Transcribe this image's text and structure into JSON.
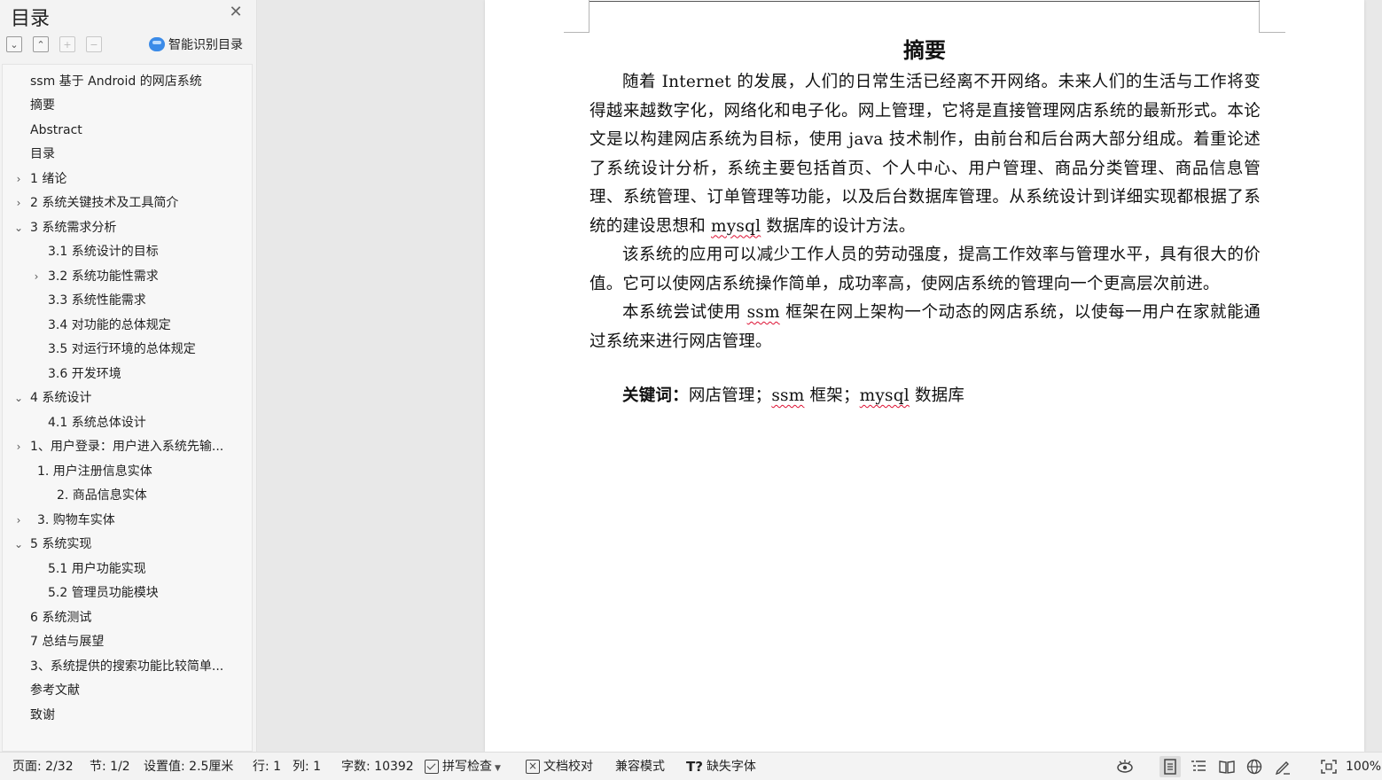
{
  "sidebar": {
    "title": "目录",
    "smart_toc_label": "智能识别目录",
    "items": [
      {
        "label": "ssm 基于 Android 的网店系统"
      },
      {
        "label": "摘要"
      },
      {
        "label": "Abstract"
      },
      {
        "label": "目录"
      },
      {
        "label": "1  绪论"
      },
      {
        "label": "2 系统关键技术及工具简介"
      },
      {
        "label": "3 系统需求分析"
      },
      {
        "label": "3.1 系统设计的目标"
      },
      {
        "label": "3.2 系统功能性需求"
      },
      {
        "label": "3.3 系统性能需求"
      },
      {
        "label": "3.4 对功能的总体规定"
      },
      {
        "label": "3.5 对运行环境的总体规定"
      },
      {
        "label": "3.6 开发环境"
      },
      {
        "label": "4 系统设计"
      },
      {
        "label": "4.1 系统总体设计"
      },
      {
        "label": "1、用户登录：用户进入系统先输..."
      },
      {
        "label": "1. 用户注册信息实体"
      },
      {
        "label": "2.  商品信息实体"
      },
      {
        "label": "3.  购物车实体"
      },
      {
        "label": "5 系统实现"
      },
      {
        "label": "5.1 用户功能实现"
      },
      {
        "label": "5.2 管理员功能模块"
      },
      {
        "label": "6 系统测试"
      },
      {
        "label": "7 总结与展望"
      },
      {
        "label": "3、系统提供的搜索功能比较简单..."
      },
      {
        "label": "参考文献"
      },
      {
        "label": "致谢"
      }
    ]
  },
  "document": {
    "title": "摘要",
    "p1": [
      {
        "text": "随着 Internet 的发展，人们的日常生活已经离不开网络。未来人们的生活与工作将变得越来越数字化，网络化和电子化。网上管理，它将是直接管理网店系统的最新形式。本论文是以构建网店系统为目标，使用 java 技术制作，由前台和后台两大部分组成。着重论述了系统设计分析，系统主要包括首页、个人中心、用户管理、商品分类管理、商品信息管理、系统管理、订单管理等功能，以及后台数据库管理。从系统设计到详细实现都根据了系统的建设思想和 "
      },
      {
        "text": "mysql",
        "spell": true
      },
      {
        "text": " 数据库的设计方法。"
      }
    ],
    "p2": "该系统的应用可以减少工作人员的劳动强度，提高工作效率与管理水平，具有很大的价值。它可以使网店系统操作简单，成功率高，使网店系统的管理向一个更高层次前进。",
    "p3": [
      {
        "text": "本系统尝试使用 "
      },
      {
        "text": "ssm",
        "spell": true
      },
      {
        "text": " 框架在网上架构一个动态的网店系统，以使每一用户在家就能通过系统来进行网店管理。"
      }
    ],
    "keywords_label": "关键词：",
    "keywords": [
      {
        "text": "网店管理；"
      },
      {
        "text": "ssm",
        "spell": true
      },
      {
        "text": " 框架；"
      },
      {
        "text": "mysql",
        "spell": true
      },
      {
        "text": " 数据库"
      }
    ]
  },
  "status_bar": {
    "page": "页面: 2/32",
    "section": "节: 1/2",
    "setting": "设置值: 2.5厘米",
    "row": "行: 1",
    "col": "列: 1",
    "word_count": "字数: 10392",
    "spell_check": "拼写检查",
    "doc_proof": "文档校对",
    "compat_mode": "兼容模式",
    "missing_fonts": "缺失字体",
    "zoom": "100%"
  },
  "colors": {
    "accent": "#3b8be8",
    "spell_underline": "#dd1133"
  }
}
